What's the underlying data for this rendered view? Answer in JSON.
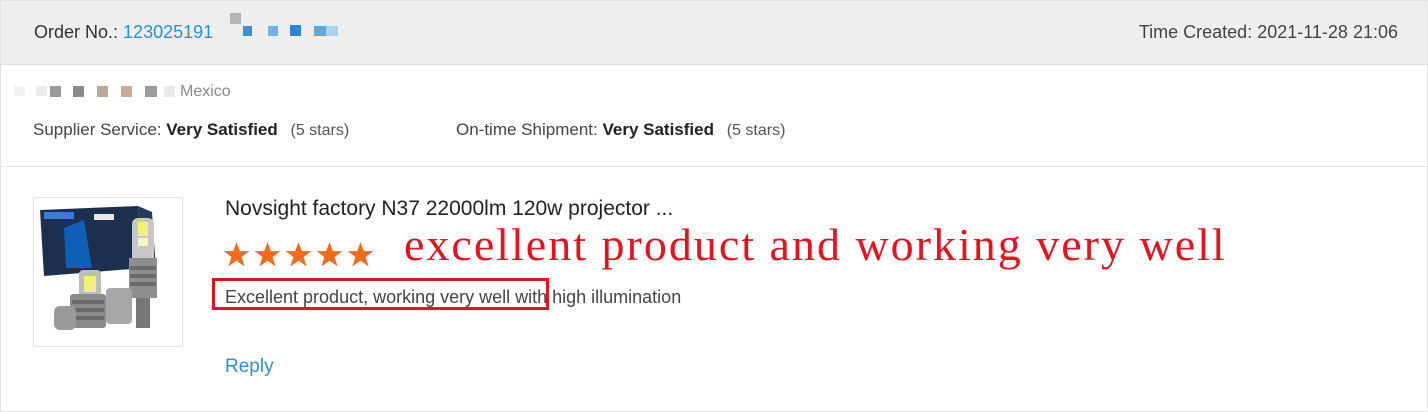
{
  "order": {
    "label": "Order No.:",
    "number": "123025191",
    "time_label": "Time Created:",
    "time_value": "2021-11-28 21:06"
  },
  "buyer": {
    "country": "Mexico"
  },
  "ratings": {
    "supplier_label": "Supplier Service:",
    "supplier_value": "Very Satisfied",
    "supplier_stars": "(5 stars)",
    "shipment_label": "On-time Shipment:",
    "shipment_value": "Very Satisfied",
    "shipment_stars": "(5 stars)"
  },
  "review": {
    "product_title": "Novsight factory N37 22000lm 120w projector ...",
    "star_rating": 5,
    "text": "Excellent product, working very well with high illumination",
    "reply_label": "Reply"
  },
  "annotation": {
    "text": "excellent product and working very well",
    "color": "#e8121e"
  },
  "colors": {
    "link": "#2a8fd6",
    "star": "#f26b1d",
    "header_bg": "#eeeeee"
  }
}
